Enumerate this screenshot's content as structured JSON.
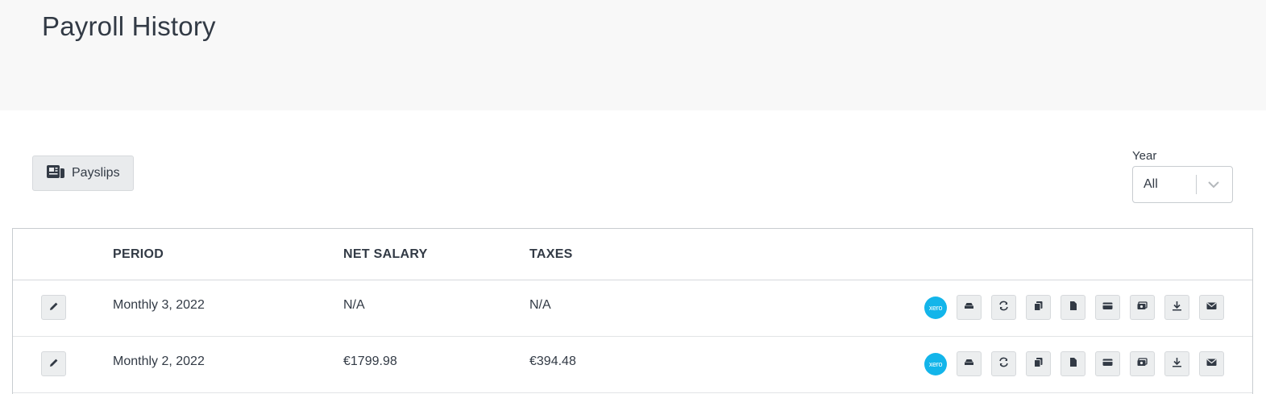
{
  "header": {
    "title": "Payroll History"
  },
  "toolbar": {
    "payslips_label": "Payslips"
  },
  "year_filter": {
    "label": "Year",
    "selected": "All"
  },
  "table": {
    "columns": [
      "PERIOD",
      "NET SALARY",
      "TAXES"
    ],
    "rows": [
      {
        "period": "Monthly 3, 2022",
        "net_salary": "N/A",
        "taxes": "N/A"
      },
      {
        "period": "Monthly 2, 2022",
        "net_salary": "€1799.98",
        "taxes": "€394.48"
      }
    ]
  },
  "actions": {
    "xero_label": "xero",
    "icons": [
      "bank-icon",
      "sync-icon",
      "copy-icon",
      "file-icon",
      "card-icon",
      "money-icon",
      "download-icon",
      "envelope-icon"
    ]
  },
  "colors": {
    "xero": "#13b5ea",
    "header_bg": "#f8f8f8",
    "text": "#323a45"
  }
}
